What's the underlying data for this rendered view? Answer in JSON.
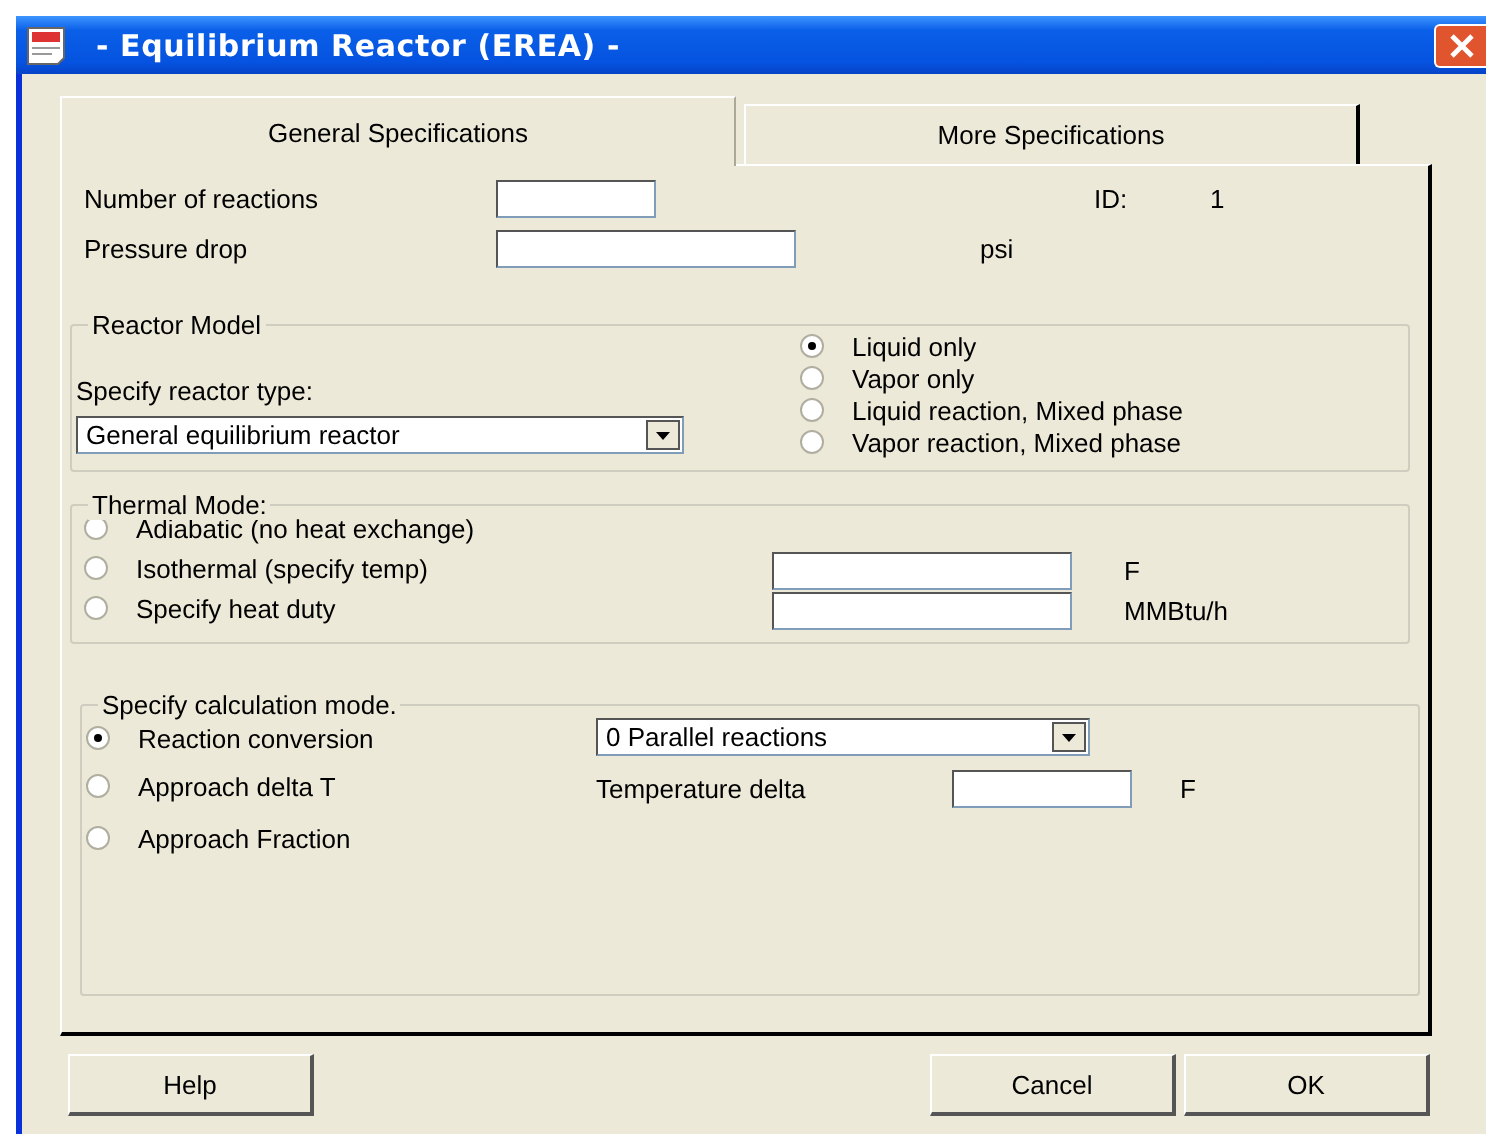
{
  "window": {
    "title": "- Equilibrium Reactor (EREA) -"
  },
  "tabs": [
    {
      "label": "General Specifications",
      "selected": true
    },
    {
      "label": "More Specifications",
      "selected": false
    }
  ],
  "id": {
    "label": "ID:",
    "value": "1"
  },
  "fields": [
    {
      "label": "Number of reactions"
    },
    {
      "label": "Pressure drop",
      "unit": "psi"
    }
  ],
  "reactor_model": {
    "title": "Reactor Model",
    "type_label": "Specify reactor type:",
    "reactor_type": "General equilibrium reactor",
    "phases": [
      {
        "label": "Liquid only",
        "selected": true
      },
      {
        "label": "Vapor only",
        "selected": false
      },
      {
        "label": "Liquid reaction, Mixed phase",
        "selected": false
      },
      {
        "label": "Vapor reaction, Mixed phase",
        "selected": false
      }
    ]
  },
  "thermal_mode": {
    "title": "Thermal Mode:",
    "options": [
      {
        "label": "Adiabatic (no heat exchange)",
        "selected": false
      },
      {
        "label": "Isothermal (specify temp)",
        "selected": false,
        "unit": "F"
      },
      {
        "label": "Specify heat duty",
        "selected": false,
        "unit": "MMBtu/h"
      }
    ]
  },
  "calculation_mode": {
    "title": "Specify calculation mode.",
    "options": [
      {
        "label": "Reaction conversion",
        "selected": true,
        "kind": "dropdown",
        "value": "0 Parallel reactions"
      },
      {
        "label": "Approach delta T",
        "selected": false,
        "kind": "field",
        "field_label": "Temperature delta",
        "unit": "F"
      },
      {
        "label": "Approach Fraction",
        "selected": false
      }
    ]
  },
  "buttons": [
    {
      "label": "Help"
    },
    {
      "label": "Cancel"
    },
    {
      "label": "OK"
    }
  ]
}
